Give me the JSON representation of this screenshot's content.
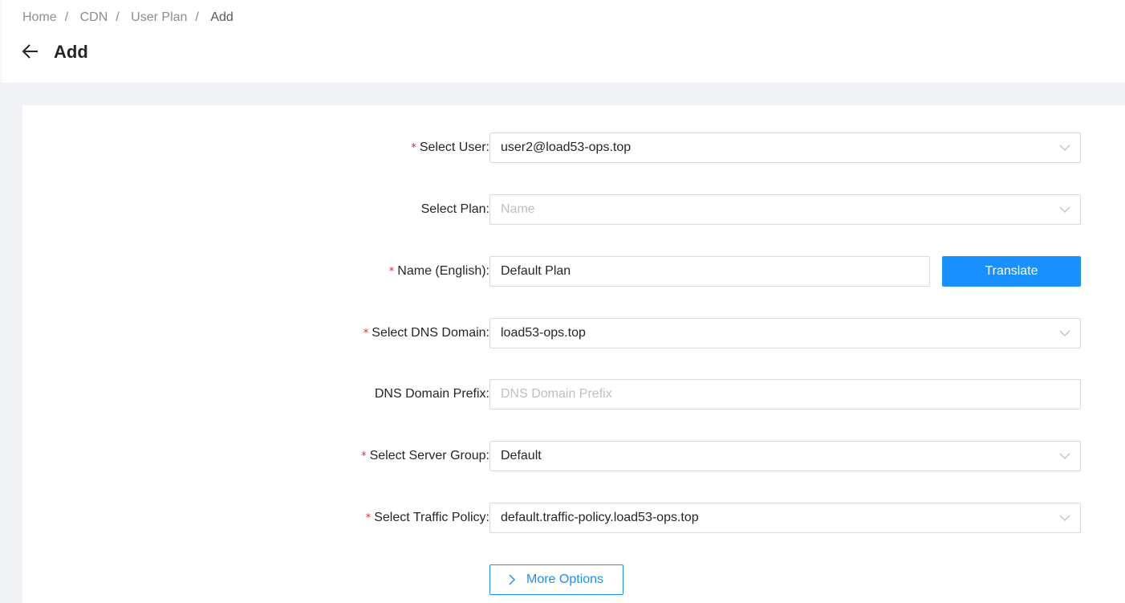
{
  "breadcrumb": [
    "Home",
    "CDN",
    "User Plan",
    "Add"
  ],
  "title": "Add",
  "form": {
    "user": {
      "label": "Select User",
      "value": "user2@load53-ops.top",
      "required": true
    },
    "plan": {
      "label": "Select Plan",
      "placeholder": "Name",
      "required": false
    },
    "name": {
      "label": "Name (English)",
      "value": "Default Plan",
      "required": true,
      "button": "Translate"
    },
    "dns_domain": {
      "label": "Select DNS Domain",
      "value": "load53-ops.top",
      "required": true
    },
    "dns_prefix": {
      "label": "DNS Domain Prefix",
      "placeholder": "DNS Domain Prefix",
      "required": false
    },
    "server_group": {
      "label": "Select Server Group",
      "value": "Default",
      "required": true
    },
    "traffic_policy": {
      "label": "Select Traffic Policy",
      "value": "default.traffic-policy.load53-ops.top",
      "required": true
    },
    "more_options": "More Options"
  },
  "colon": ":",
  "required_mark": "*"
}
